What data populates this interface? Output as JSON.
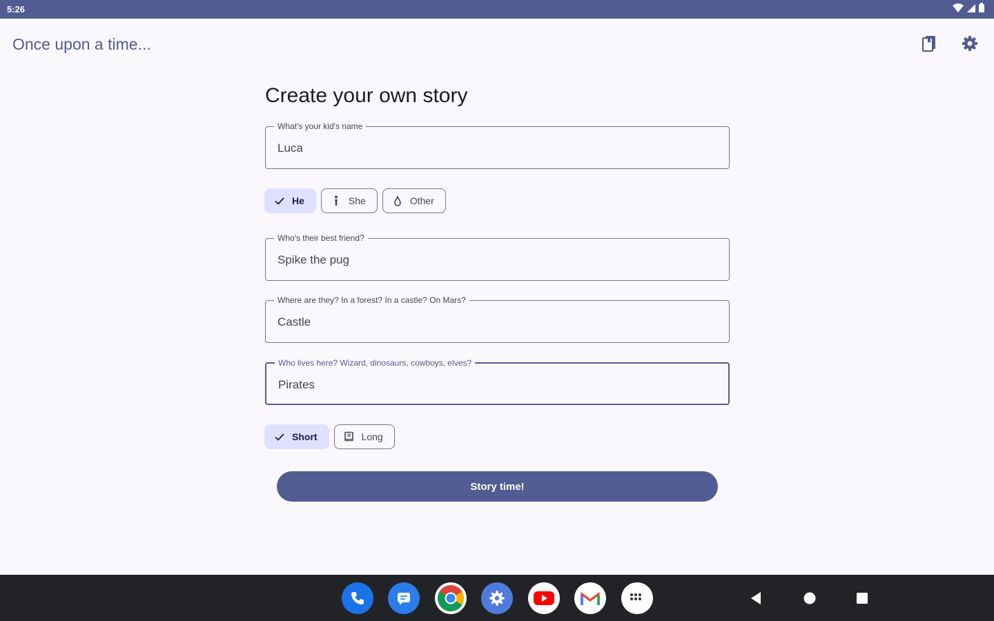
{
  "status_bar": {
    "time": "5:26",
    "icons": [
      "wifi-icon",
      "signal-icon",
      "battery-icon"
    ]
  },
  "app_bar": {
    "title": "Once upon a time...",
    "actions": [
      {
        "icon": "saved-stories-icon"
      },
      {
        "icon": "settings-gear-icon"
      }
    ]
  },
  "form": {
    "heading": "Create your own story",
    "name_field": {
      "label": "What's your kid's name",
      "value": "Luca"
    },
    "pronoun_chips": [
      {
        "label": "He",
        "icon": "check-icon",
        "selected": true
      },
      {
        "label": "She",
        "icon": "female-icon",
        "selected": false
      },
      {
        "label": "Other",
        "icon": "drop-icon",
        "selected": false
      }
    ],
    "friend_field": {
      "label": "Who's their best friend?",
      "value": "Spike the pug"
    },
    "place_field": {
      "label": "Where are they? In a forest? In a castle? On Mars?",
      "value": "Castle"
    },
    "inhabitants_field": {
      "label": "Who lives here? Wizard, dinosaurs, cowboys, elves?",
      "value": "Pirates"
    },
    "length_chips": [
      {
        "label": "Short",
        "icon": "check-icon",
        "selected": true
      },
      {
        "label": "Long",
        "icon": "book-icon",
        "selected": false
      }
    ],
    "submit_label": "Story time!"
  },
  "taskbar": {
    "apps": [
      "phone-app-icon",
      "messages-app-icon",
      "chrome-app-icon",
      "settings-app-icon",
      "youtube-app-icon",
      "gmail-app-icon",
      "app-drawer-icon"
    ],
    "nav_buttons": [
      "back-icon",
      "home-icon",
      "recents-icon"
    ]
  },
  "colors": {
    "primary": "#515c92",
    "background": "#fbf8fd",
    "chip_selected": "#dfe0ff",
    "outline": "#767680",
    "taskbar": "#222327"
  }
}
